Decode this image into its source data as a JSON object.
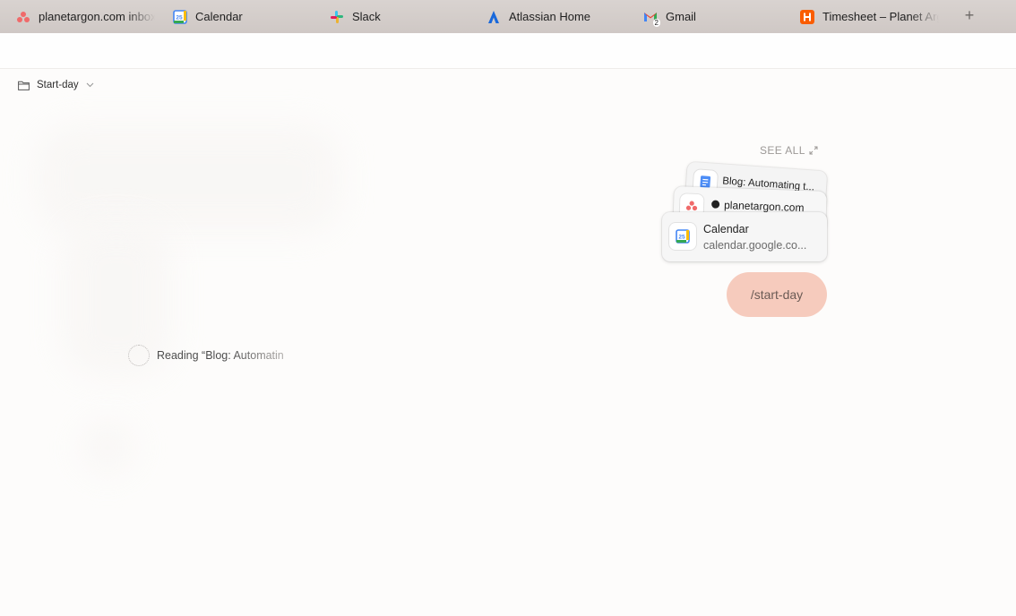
{
  "tabs": [
    {
      "label": "planetargon.com inbox",
      "icon": "asana-icon"
    },
    {
      "label": "Calendar",
      "icon": "google-calendar-icon"
    },
    {
      "label": "Slack",
      "icon": "slack-icon"
    },
    {
      "label": "Atlassian Home",
      "icon": "atlassian-icon"
    },
    {
      "label": "Gmail",
      "icon": "gmail-icon",
      "badge": "2"
    },
    {
      "label": "Timesheet – Planet Argon",
      "icon": "harvest-icon"
    }
  ],
  "new_tab": "+",
  "crumb": {
    "label": "Start-day",
    "icon": "folder-icon"
  },
  "sources": {
    "see_all": "SEE ALL",
    "cards": [
      {
        "title": "Blog: Automating t...",
        "icon": "document-icon"
      },
      {
        "title": "planetargon.com",
        "icon": "asana-icon"
      },
      {
        "title": "Calendar",
        "subtitle": "calendar.google.co...",
        "icon": "google-calendar-icon"
      }
    ]
  },
  "slash_command": "/start-day",
  "status": {
    "text": "Reading “Blog: Automatin"
  },
  "colors": {
    "tabbar": "#d3ccc9",
    "bubble": "#f6cbbd",
    "asana": "#f06a6a",
    "atlassian": "#1868db",
    "harvest": "#fa5d00"
  }
}
